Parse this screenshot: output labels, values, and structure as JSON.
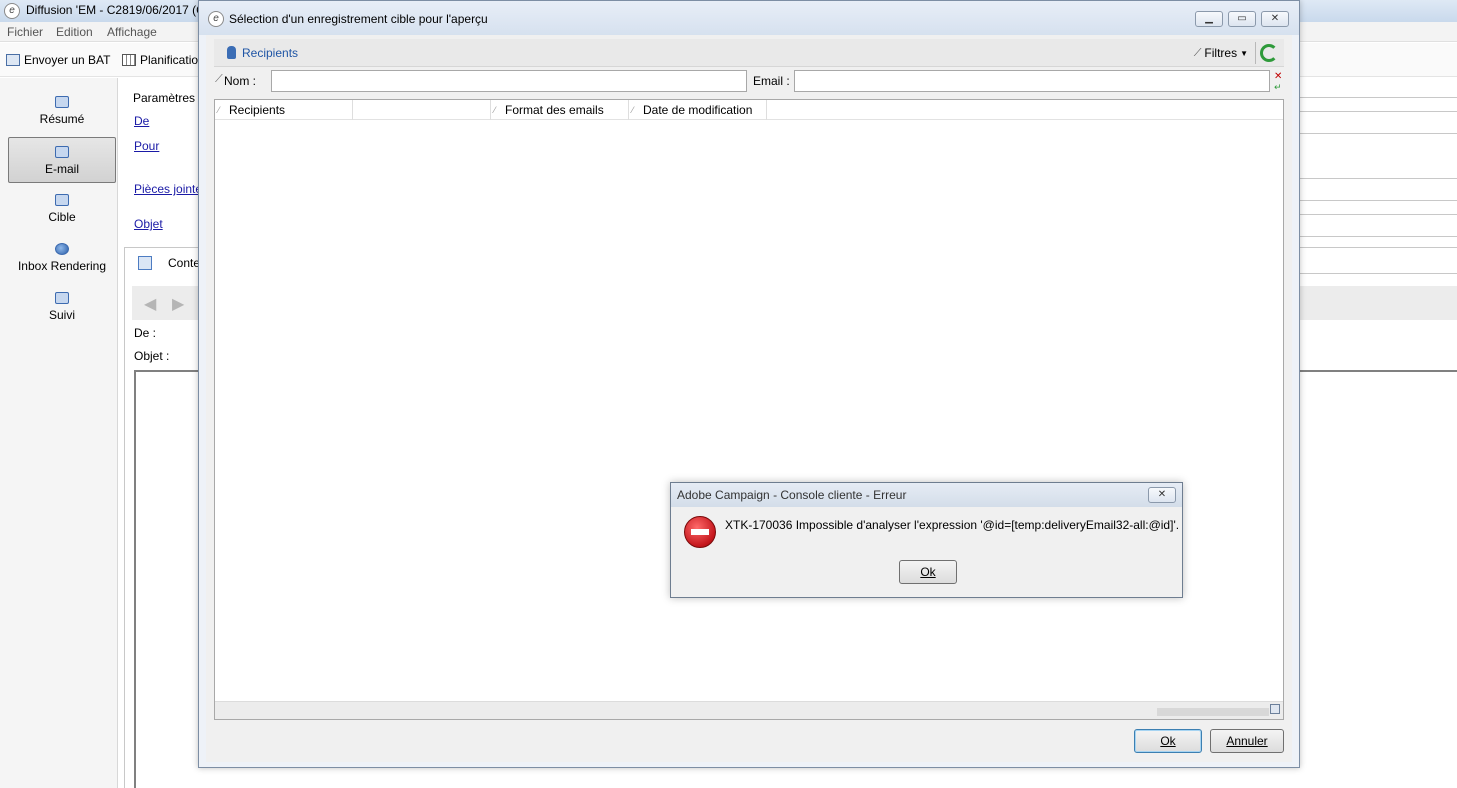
{
  "main_window": {
    "title": "Diffusion 'EM - C2819/06/2017 (C",
    "menu": [
      "Fichier",
      "Edition",
      "Affichage"
    ],
    "toolbar": {
      "send_proof": "Envoyer un BAT",
      "planning": "Planificatio"
    },
    "nav": [
      {
        "label": "Résumé",
        "icon": "summary-icon"
      },
      {
        "label": "E-mail",
        "icon": "email-icon",
        "active": true
      },
      {
        "label": "Cible",
        "icon": "target-icon"
      },
      {
        "label": "Inbox Rendering",
        "icon": "globe-icon"
      },
      {
        "label": "Suivi",
        "icon": "tracking-icon"
      }
    ],
    "params_title": "Paramètres d",
    "links": {
      "from": "De",
      "to": "Pour",
      "attachments": "Pièces jointe",
      "subject": "Objet"
    },
    "content_tab": "Conte",
    "preview": {
      "from_label": "De :",
      "subject_label": "Objet :"
    }
  },
  "selection_dialog": {
    "title": "Sélection d'un enregistrement cible pour l'aperçu",
    "filter_bar": {
      "recipients": "Recipients",
      "filters": "Filtres"
    },
    "fields": {
      "name_label": "Nom :",
      "name_value": "",
      "email_label": "Email :",
      "email_value": ""
    },
    "columns": [
      "Recipients",
      "",
      "Format des emails",
      "Date de modification"
    ],
    "rows": [],
    "buttons": {
      "ok": "Ok",
      "cancel": "Annuler"
    }
  },
  "error_dialog": {
    "title": "Adobe Campaign - Console cliente - Erreur",
    "message": "XTK-170036 Impossible d'analyser l'expression '@id=[temp:deliveryEmail32-all:@id]'.",
    "button": "Ok",
    "icon": "error-stop-icon"
  },
  "colors": {
    "link": "#1a1aa6",
    "accent": "#1f55a5",
    "error": "#c4161c",
    "refresh": "#2e9a3a"
  }
}
